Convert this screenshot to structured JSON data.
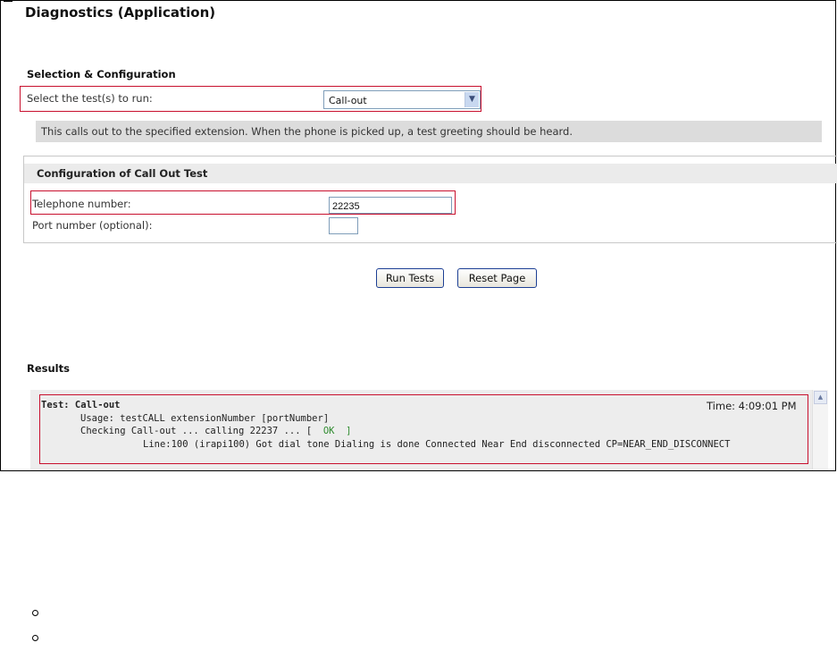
{
  "page": {
    "title": "Diagnostics (Application)"
  },
  "selection": {
    "heading": "Selection & Configuration",
    "label": "Select the test(s) to run:",
    "selected": "Call-out",
    "description": "This calls out to the specified extension. When the phone is picked up, a test greeting should be heard."
  },
  "config": {
    "heading": "Configuration of Call Out Test",
    "telephone_label": "Telephone number:",
    "telephone_value": "22235",
    "port_label": "Port number (optional):",
    "port_value": ""
  },
  "buttons": {
    "run": "Run Tests",
    "reset": "Reset Page"
  },
  "results": {
    "heading": "Results",
    "test_line": "Test: Call-out",
    "time": "Time: 4:09:01 PM",
    "usage_line": "Usage: testCALL extensionNumber [portNumber]",
    "checking_line": "Checking Call-out ... calling 22237 ... [  ",
    "ok_text": "OK",
    "ok_close": "  ]",
    "detail_line": "Line:100 (irapi100) Got dial tone Dialing is done Connected Near End disconnected CP=NEAR_END_DISCONNECT"
  },
  "colors": {
    "highlight_border": "#c8102e",
    "ok": "#2e8b2e",
    "info_bar": "#dcdcdc"
  }
}
